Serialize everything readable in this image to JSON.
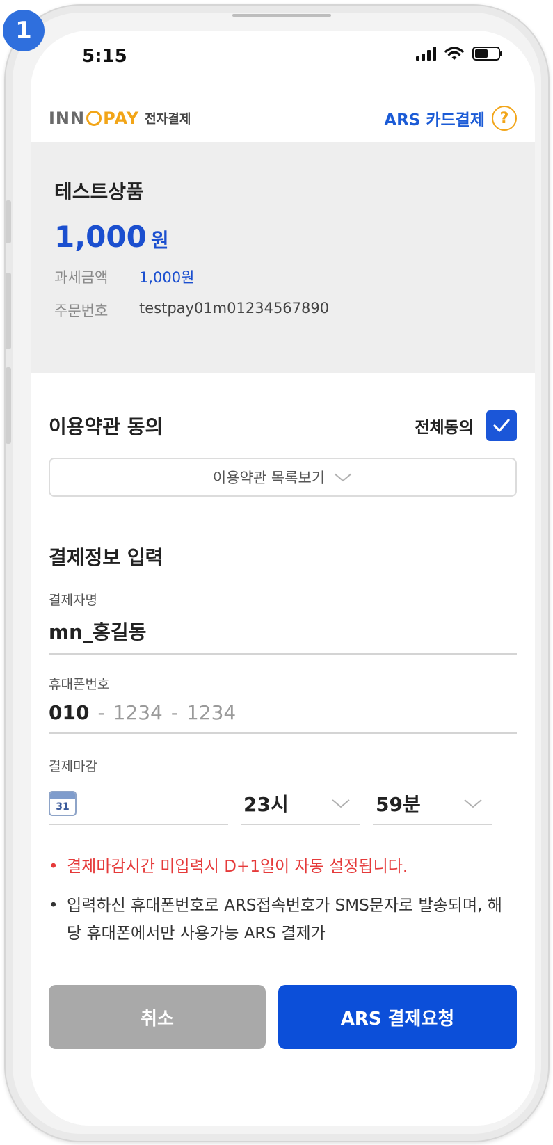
{
  "badge": "1",
  "status_bar": {
    "time": "5:15"
  },
  "header": {
    "logo_inn": "INN",
    "logo_pay": "PAY",
    "logo_sub": "전자결제",
    "title": "ARS 카드결제",
    "help_glyph": "?"
  },
  "product": {
    "name": "테스트상품",
    "price": "1,000",
    "price_unit": "원",
    "tax_label": "과세금액",
    "tax_value": "1,000원",
    "order_label": "주문번호",
    "order_value": "testpay01m01234567890"
  },
  "terms": {
    "title": "이용약관 동의",
    "agree_all_label": "전체동의",
    "agree_all_checked": true,
    "view_list_label": "이용약관 목록보기"
  },
  "payment_info": {
    "title": "결제정보 입력",
    "payer_label": "결제자명",
    "payer_value": "mn_홍길동",
    "phone_label": "휴대폰번호",
    "phone_prefix": "010",
    "phone_mid": "1234",
    "phone_last": "1234",
    "deadline_label": "결제마감",
    "calendar_day": "31",
    "deadline_hour": "23시",
    "deadline_minute": "59분"
  },
  "notices": {
    "red": "결제마감시간 미입력시 D+1일이 자동 설정됩니다.",
    "gray": "입력하신 휴대폰번호로 ARS접속번호가 SMS문자로 발송되며, 해당 휴대폰에서만 사용가능 ARS 결제가"
  },
  "buttons": {
    "cancel": "취소",
    "submit": "ARS 결제요청"
  },
  "colors": {
    "accent_blue": "#0c4fd9",
    "brand_orange": "#f2a518",
    "notice_red": "#e53a3a"
  }
}
